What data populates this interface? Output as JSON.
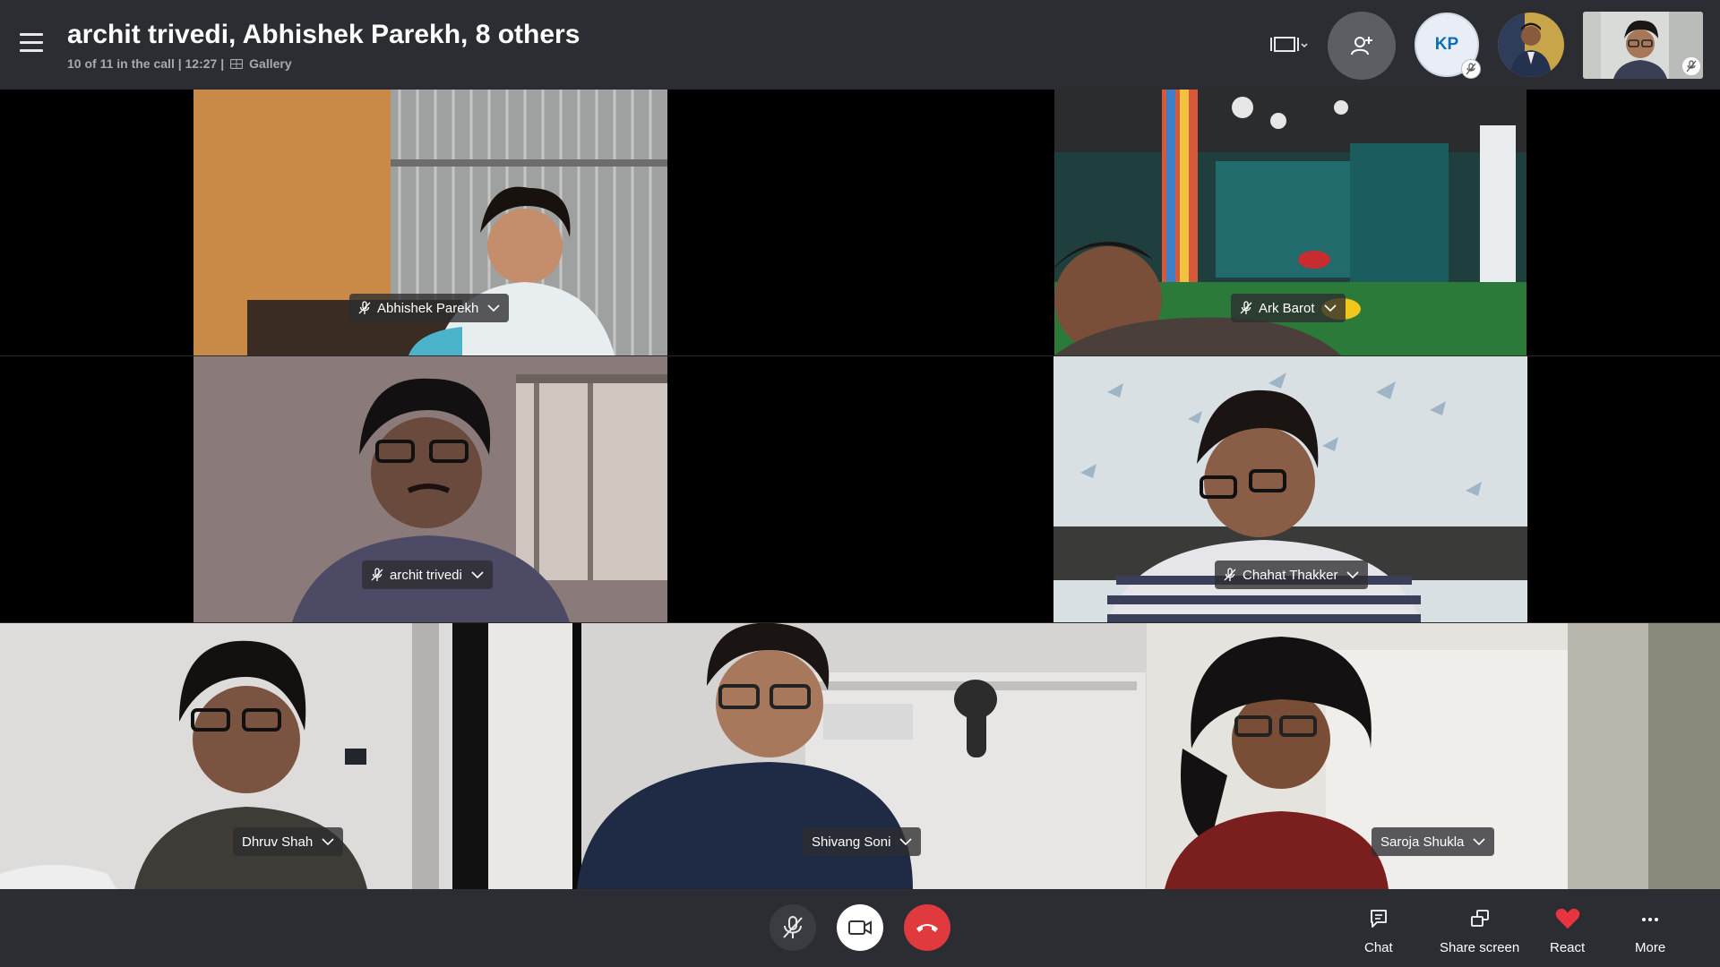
{
  "header": {
    "title": "archit trivedi, Abhishek Parekh, 8 others",
    "call_status": "10 of 11 in the call | 12:27 |",
    "view_mode": "Gallery"
  },
  "participants_strip": {
    "avatar_initials": "KP"
  },
  "tiles": [
    {
      "name": "Abhishek Parekh"
    },
    {
      "name": "Ark Barot"
    },
    {
      "name": "archit trivedi"
    },
    {
      "name": "Chahat Thakker"
    },
    {
      "name": "Dhruv Shah"
    },
    {
      "name": "Shivang Soni"
    },
    {
      "name": "Saroja Shukla"
    }
  ],
  "controls": {
    "mic": "microphone-muted-icon",
    "video": "video-camera-icon",
    "hangup": "hang-up-icon"
  },
  "actions": [
    {
      "label": "Chat"
    },
    {
      "label": "Share screen"
    },
    {
      "label": "React"
    },
    {
      "label": "More"
    }
  ],
  "colors": {
    "bar_bg": "#2b2d33",
    "hangup": "#e0393e",
    "react_heart": "#e8343f",
    "avatar_text": "#0a6fb8"
  }
}
